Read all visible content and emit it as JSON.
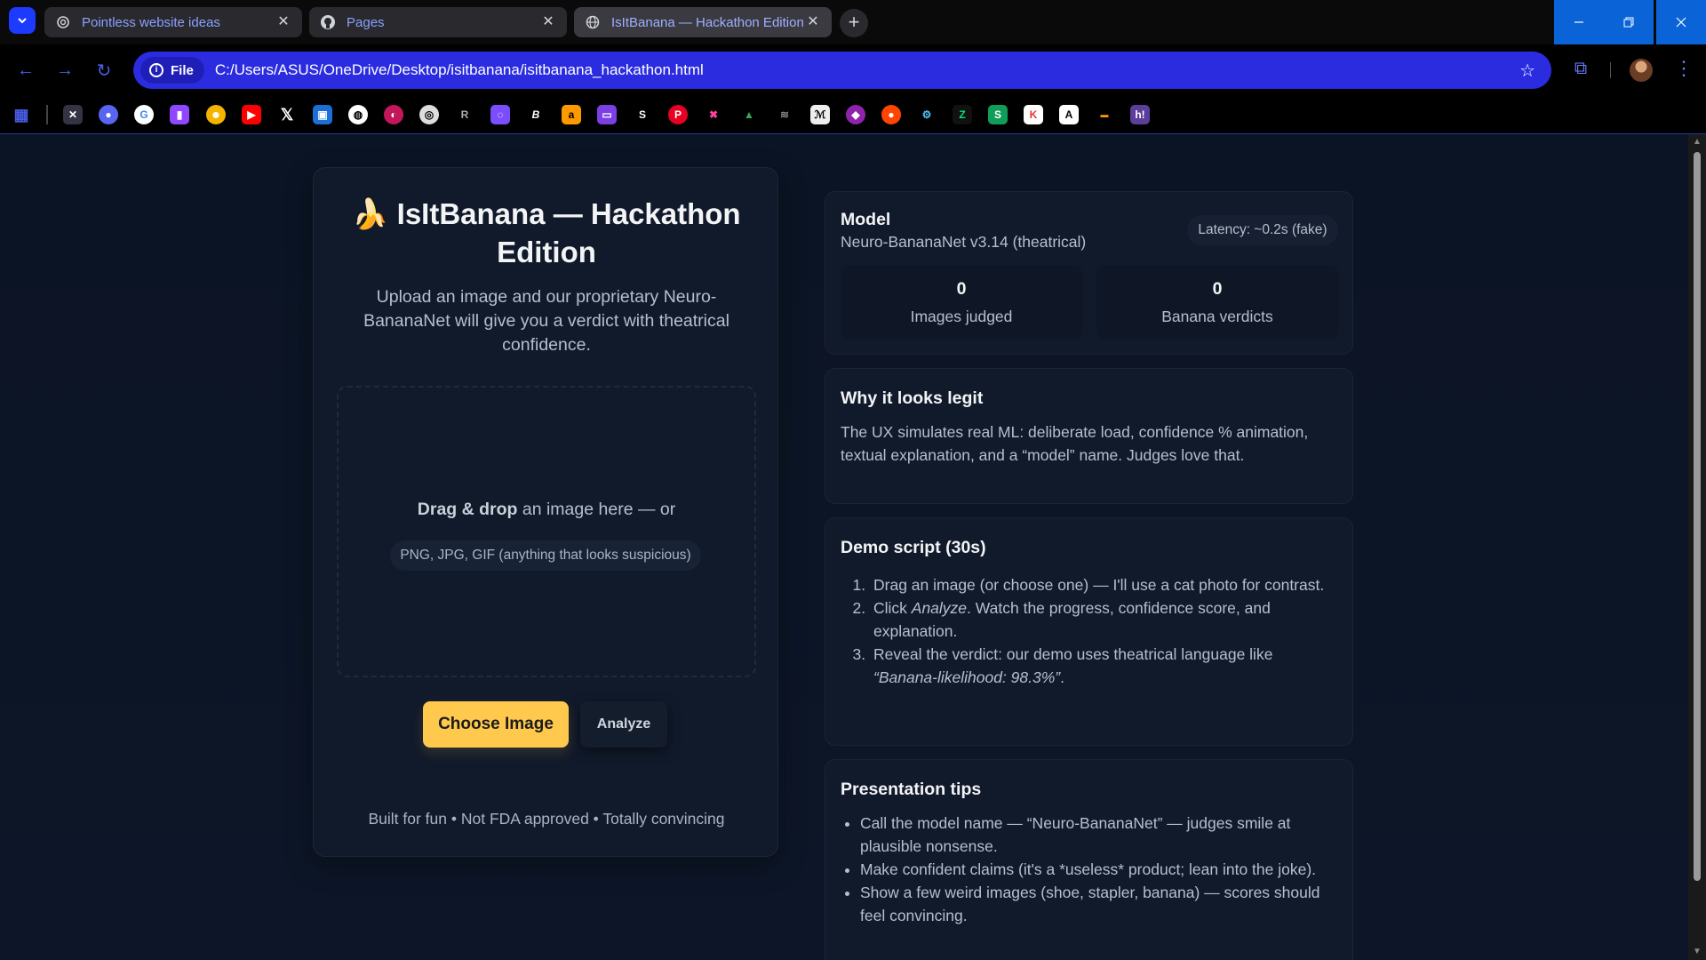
{
  "browser": {
    "tabs": [
      {
        "title": "Pointless website ideas",
        "icon": "openai-icon"
      },
      {
        "title": "Pages",
        "icon": "github-icon"
      },
      {
        "title": "IsItBanana — Hackathon Edition",
        "icon": "globe-icon"
      }
    ],
    "file_chip": "File",
    "url": "C:/Users/ASUS/OneDrive/Desktop/isitbanana/isitbanana_hackathon.html"
  },
  "app": {
    "title": "🍌 IsItBanana — Hackathon Edition",
    "subtitle": "Upload an image and our proprietary Neuro-BananaNet will give you a verdict with theatrical confidence.",
    "dropzone": {
      "bold": "Drag & drop",
      "text": " an image here — or",
      "hint": "PNG, JPG, GIF (anything that looks suspicious)"
    },
    "choose_label": "Choose Image",
    "analyze_label": "Analyze",
    "footer": "Built for fun • Not FDA approved • Totally convincing"
  },
  "model": {
    "label": "Model",
    "name": "Neuro-BananaNet v3.14 (theatrical)",
    "latency": "Latency: ~0.2s (fake)",
    "stats": [
      {
        "value": "0",
        "label": "Images judged"
      },
      {
        "value": "0",
        "label": "Banana verdicts"
      }
    ]
  },
  "legit": {
    "heading": "Why it looks legit",
    "body": "The UX simulates real ML: deliberate load, confidence % animation, textual explanation, and a “model” name. Judges love that."
  },
  "demo": {
    "heading": "Demo script (30s)",
    "steps": [
      {
        "a": "Drag an image (or choose one) — I'll use a cat photo for contrast.",
        "em": "",
        "b": ""
      },
      {
        "a": "Click ",
        "em": "Analyze",
        "b": ". Watch the progress, confidence score, and explanation."
      },
      {
        "a": "Reveal the verdict: our demo uses theatrical language like ",
        "em": "“Banana-likelihood: 98.3%”",
        "b": "."
      }
    ]
  },
  "tips": {
    "heading": "Presentation tips",
    "items": [
      "Call the model name — “Neuro-BananaNet” — judges smile at plausible nonsense.",
      "Make confident claims (it's a *useless* product; lean into the joke).",
      "Show a few weird images (shoe, stapler, banana) — scores should feel convincing."
    ]
  },
  "colors": {
    "accent": "#ffc94d",
    "omnibox": "#2b2ce0",
    "page_bg": "#0b1424",
    "card_bg": "#111a2b"
  }
}
